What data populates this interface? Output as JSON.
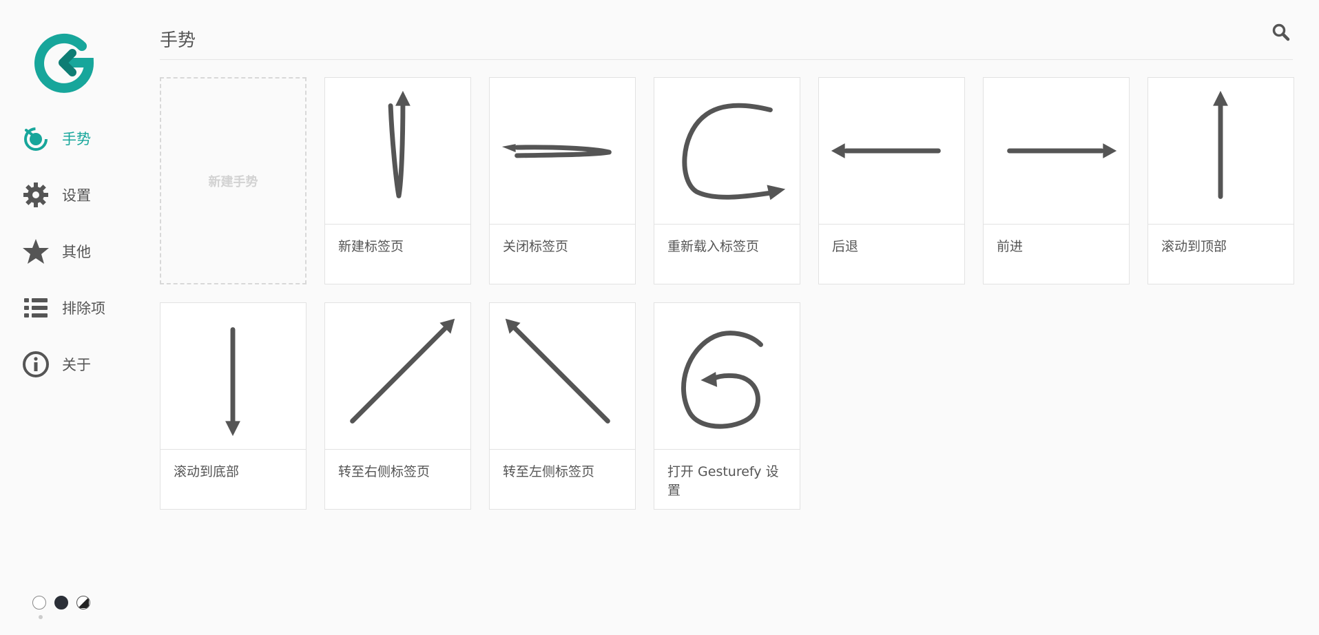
{
  "sidebar": {
    "logo_icon": "gesturefy-logo-icon",
    "brand_color": "#17a69b",
    "items": [
      {
        "label": "手势",
        "icon": "gesture-icon",
        "active": true
      },
      {
        "label": "设置",
        "icon": "gear-icon",
        "active": false
      },
      {
        "label": "其他",
        "icon": "star-icon",
        "active": false
      },
      {
        "label": "排除项",
        "icon": "list-icon",
        "active": false
      },
      {
        "label": "关于",
        "icon": "info-icon",
        "active": false
      }
    ],
    "themes": [
      "light",
      "dark",
      "high-contrast"
    ]
  },
  "header": {
    "title": "手势",
    "search_icon": "search-icon"
  },
  "new_gesture": {
    "label": "新建手势"
  },
  "gestures": [
    {
      "label": "新建标签页",
      "icon": "up-down-up-stroke-icon"
    },
    {
      "label": "关闭标签页",
      "icon": "right-left-stroke-icon"
    },
    {
      "label": "重新载入标签页",
      "icon": "c-curve-stroke-icon"
    },
    {
      "label": "后退",
      "icon": "arrow-left-icon"
    },
    {
      "label": "前进",
      "icon": "arrow-right-icon"
    },
    {
      "label": "滚动到顶部",
      "icon": "arrow-up-icon"
    },
    {
      "label": "滚动到底部",
      "icon": "arrow-down-icon"
    },
    {
      "label": "转至右侧标签页",
      "icon": "arrow-up-right-icon"
    },
    {
      "label": "转至左侧标签页",
      "icon": "arrow-up-left-icon"
    },
    {
      "label": "打开 Gesturefy 设置",
      "icon": "g-curve-stroke-icon"
    }
  ],
  "colors": {
    "accent": "#17a69b",
    "stroke": "#555555",
    "background": "#fafafa"
  }
}
